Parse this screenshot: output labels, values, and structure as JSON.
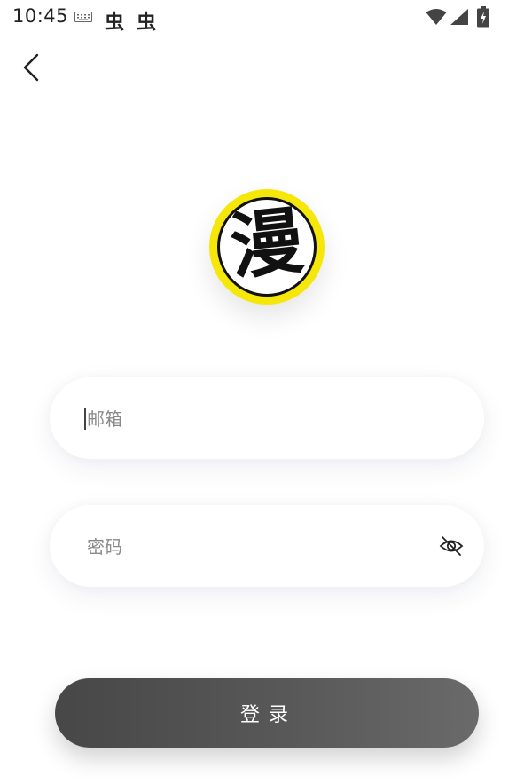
{
  "status_bar": {
    "time": "10:45",
    "notification_icons": [
      "虫",
      "虫"
    ],
    "icons": [
      "keyboard-icon",
      "wifi-icon",
      "signal-icon",
      "battery-charging-icon"
    ]
  },
  "nav": {
    "back_icon": "chevron-left-icon"
  },
  "logo": {
    "text": "漫",
    "ring_color": "#f6e70b"
  },
  "form": {
    "email": {
      "placeholder": "邮箱",
      "value": ""
    },
    "password": {
      "placeholder": "密码",
      "value": "",
      "toggle_icon": "eye-off-icon"
    },
    "login_label": "登录"
  },
  "colors": {
    "button": "#555555",
    "accent": "#f6e70b"
  }
}
